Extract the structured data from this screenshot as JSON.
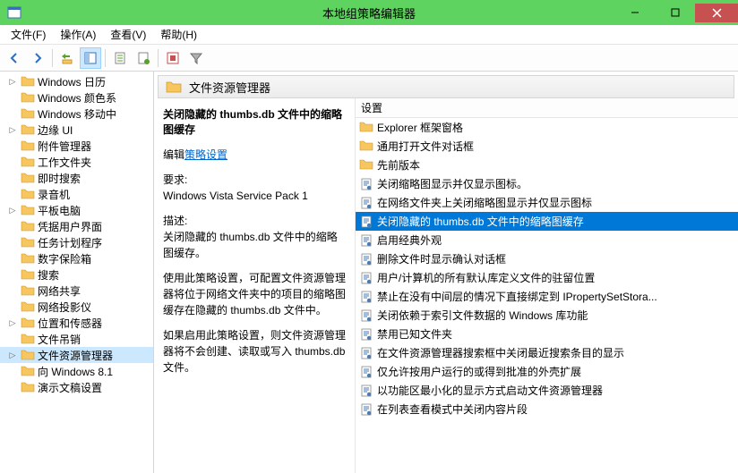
{
  "window": {
    "title": "本地组策略编辑器"
  },
  "menu": {
    "file": "文件(F)",
    "action": "操作(A)",
    "view": "查看(V)",
    "help": "帮助(H)"
  },
  "tree": {
    "items": [
      {
        "label": "Windows 日历",
        "exp": ">"
      },
      {
        "label": "Windows 颜色系",
        "exp": ""
      },
      {
        "label": "Windows 移动中",
        "exp": ""
      },
      {
        "label": "边缘 UI",
        "exp": ">"
      },
      {
        "label": "附件管理器",
        "exp": ""
      },
      {
        "label": "工作文件夹",
        "exp": ""
      },
      {
        "label": "即时搜索",
        "exp": ""
      },
      {
        "label": "录音机",
        "exp": ""
      },
      {
        "label": "平板电脑",
        "exp": ">"
      },
      {
        "label": "凭据用户界面",
        "exp": ""
      },
      {
        "label": "任务计划程序",
        "exp": ""
      },
      {
        "label": "数字保险箱",
        "exp": ""
      },
      {
        "label": "搜索",
        "exp": ""
      },
      {
        "label": "网络共享",
        "exp": ""
      },
      {
        "label": "网络投影仪",
        "exp": ""
      },
      {
        "label": "位置和传感器",
        "exp": ">"
      },
      {
        "label": "文件吊销",
        "exp": ""
      },
      {
        "label": "文件资源管理器",
        "exp": ">",
        "selected": true
      },
      {
        "label": "向 Windows 8.1",
        "exp": ""
      },
      {
        "label": "演示文稿设置",
        "exp": ""
      }
    ]
  },
  "header": {
    "title": "文件资源管理器"
  },
  "description": {
    "title": "关闭隐藏的 thumbs.db 文件中的缩略图缓存",
    "edit_prefix": "编辑",
    "edit_link": "策略设置",
    "req_label": "要求:",
    "req_value": "Windows Vista Service Pack 1",
    "desc_label": "描述:",
    "desc_p1": "关闭隐藏的 thumbs.db 文件中的缩略图缓存。",
    "desc_p2": "使用此策略设置，可配置文件资源管理器将位于网络文件夹中的项目的缩略图缓存在隐藏的 thumbs.db 文件中。",
    "desc_p3": "如果启用此策略设置，则文件资源管理器将不会创建、读取或写入 thumbs.db 文件。"
  },
  "list": {
    "header": "设置",
    "items": [
      {
        "type": "folder",
        "label": "Explorer 框架窗格"
      },
      {
        "type": "folder",
        "label": "通用打开文件对话框"
      },
      {
        "type": "folder",
        "label": "先前版本"
      },
      {
        "type": "setting",
        "label": "关闭缩略图显示并仅显示图标。"
      },
      {
        "type": "setting",
        "label": "在网络文件夹上关闭缩略图显示并仅显示图标"
      },
      {
        "type": "setting",
        "label": "关闭隐藏的 thumbs.db 文件中的缩略图缓存",
        "selected": true
      },
      {
        "type": "setting",
        "label": "启用经典外观"
      },
      {
        "type": "setting",
        "label": "删除文件时显示确认对话框"
      },
      {
        "type": "setting",
        "label": "用户/计算机的所有默认库定义文件的驻留位置"
      },
      {
        "type": "setting",
        "label": "禁止在没有中间层的情况下直接绑定到 IPropertySetStora..."
      },
      {
        "type": "setting",
        "label": "关闭依赖于索引文件数据的 Windows 库功能"
      },
      {
        "type": "setting",
        "label": "禁用已知文件夹"
      },
      {
        "type": "setting",
        "label": "在文件资源管理器搜索框中关闭最近搜索条目的显示"
      },
      {
        "type": "setting",
        "label": "仅允许按用户运行的或得到批准的外壳扩展"
      },
      {
        "type": "setting",
        "label": "以功能区最小化的显示方式启动文件资源管理器"
      },
      {
        "type": "setting",
        "label": "在列表查看模式中关闭内容片段"
      }
    ]
  }
}
